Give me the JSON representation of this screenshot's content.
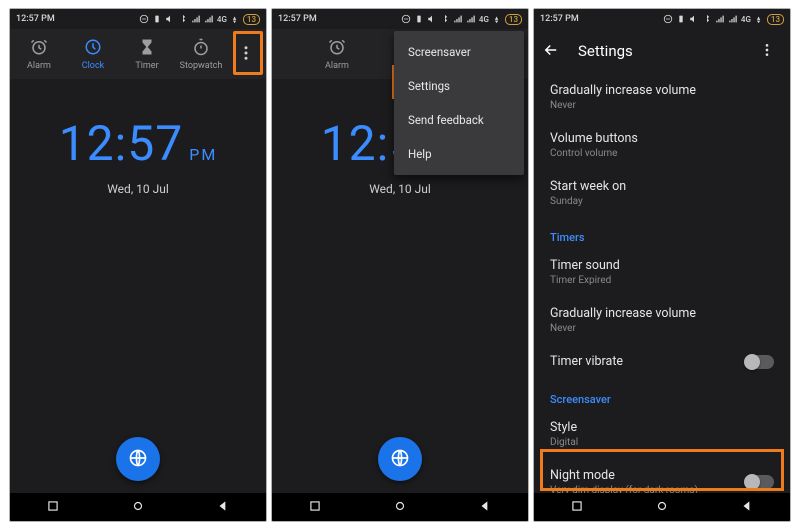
{
  "status": {
    "time": "12:57 PM",
    "network": "4G",
    "battery": "13"
  },
  "tabs": {
    "alarm": "Alarm",
    "clock": "Clock",
    "timer": "Timer",
    "stopwatch": "Stopwatch"
  },
  "clock": {
    "time": "12:57",
    "ampm": "PM",
    "date": "Wed, 10 Jul"
  },
  "menu": {
    "screensaver": "Screensaver",
    "settings": "Settings",
    "feedback": "Send feedback",
    "help": "Help"
  },
  "settings": {
    "title": "Settings",
    "items": {
      "grad_alarm": {
        "title": "Gradually increase volume",
        "sub": "Never"
      },
      "volbtn": {
        "title": "Volume buttons",
        "sub": "Control volume"
      },
      "startweek": {
        "title": "Start week on",
        "sub": "Sunday"
      },
      "cat_timers": "Timers",
      "timersound": {
        "title": "Timer sound",
        "sub": "Timer Expired"
      },
      "grad_timer": {
        "title": "Gradually increase volume",
        "sub": "Never"
      },
      "timervib": {
        "title": "Timer vibrate"
      },
      "cat_saver": "Screensaver",
      "style": {
        "title": "Style",
        "sub": "Digital"
      },
      "night": {
        "title": "Night mode",
        "sub": "Very dim display (for dark rooms)"
      }
    }
  }
}
